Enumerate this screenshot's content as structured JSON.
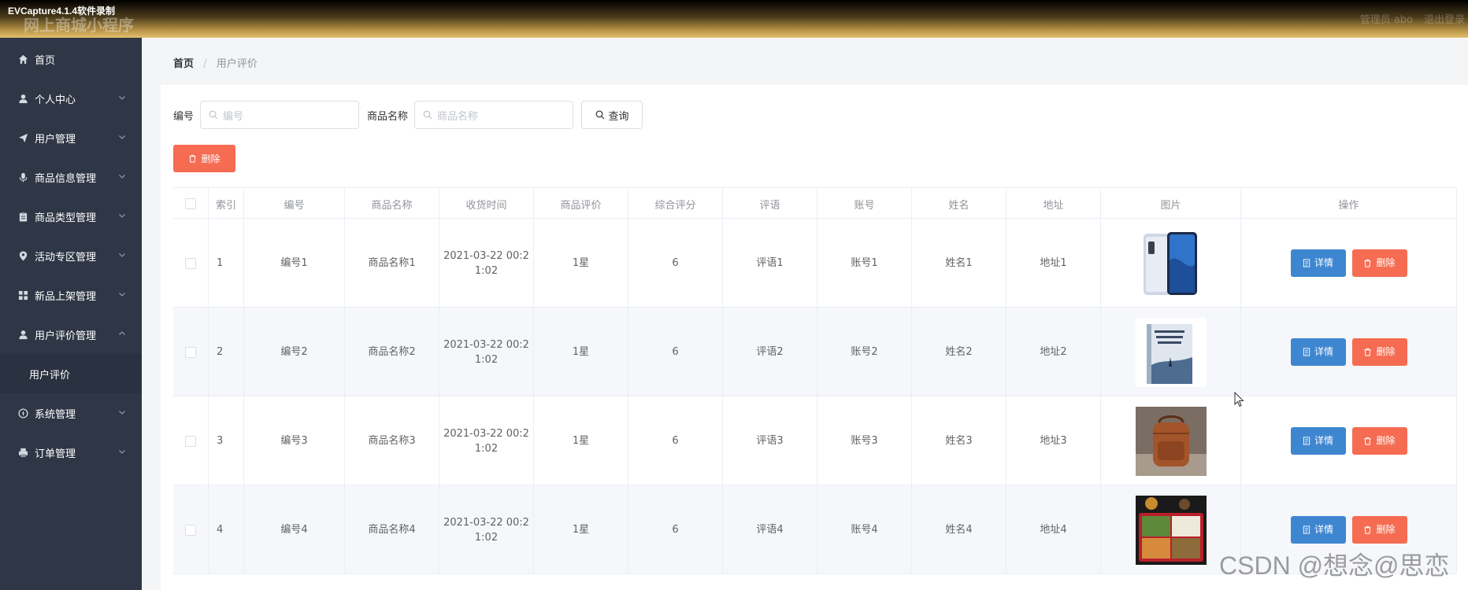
{
  "recorder": {
    "label": "EVCapture4.1.4软件录制"
  },
  "header": {
    "brand": "网上商城小程序",
    "user": "管理员 abo",
    "logout": "退出登录"
  },
  "sidebar": {
    "items": [
      {
        "label": "首页",
        "icon": "home-icon"
      },
      {
        "label": "个人中心",
        "icon": "user-icon"
      },
      {
        "label": "用户管理",
        "icon": "send-icon"
      },
      {
        "label": "商品信息管理",
        "icon": "mic-icon"
      },
      {
        "label": "商品类型管理",
        "icon": "clipboard-icon"
      },
      {
        "label": "活动专区管理",
        "icon": "location-icon"
      },
      {
        "label": "新品上架管理",
        "icon": "grid-icon"
      },
      {
        "label": "用户评价管理",
        "icon": "user-icon"
      },
      {
        "label": "系统管理",
        "icon": "settings-icon"
      },
      {
        "label": "订单管理",
        "icon": "printer-icon"
      }
    ],
    "sub_item": "用户评价"
  },
  "breadcrumb": {
    "home": "首页",
    "sep": "/",
    "current": "用户评价"
  },
  "search": {
    "field1_label": "编号",
    "field1_placeholder": "编号",
    "field2_label": "商品名称",
    "field2_placeholder": "商品名称",
    "query_label": "查询"
  },
  "toolbar": {
    "delete_label": "删除"
  },
  "table": {
    "columns": [
      "索引",
      "编号",
      "商品名称",
      "收货时间",
      "商品评价",
      "综合评分",
      "评语",
      "账号",
      "姓名",
      "地址",
      "图片",
      "操作"
    ],
    "rows": [
      {
        "index": "1",
        "code": "编号1",
        "name": "商品名称1",
        "time": "2021-03-22 00:2\n1:02",
        "rating": "1星",
        "score": "6",
        "comment": "评语1",
        "account": "账号1",
        "person": "姓名1",
        "address": "地址1",
        "image": "phone-image"
      },
      {
        "index": "2",
        "code": "编号2",
        "name": "商品名称2",
        "time": "2021-03-22 00:2\n1:02",
        "rating": "1星",
        "score": "6",
        "comment": "评语2",
        "account": "账号2",
        "person": "姓名2",
        "address": "地址2",
        "image": "book-image"
      },
      {
        "index": "3",
        "code": "编号3",
        "name": "商品名称3",
        "time": "2021-03-22 00:2\n1:02",
        "rating": "1星",
        "score": "6",
        "comment": "评语3",
        "account": "账号3",
        "person": "姓名3",
        "address": "地址3",
        "image": "bag-image"
      },
      {
        "index": "4",
        "code": "编号4",
        "name": "商品名称4",
        "time": "2021-03-22 00:2\n1:02",
        "rating": "1星",
        "score": "6",
        "comment": "评语4",
        "account": "账号4",
        "person": "姓名4",
        "address": "地址4",
        "image": "food-image"
      }
    ],
    "detail_label": "详情",
    "delete_label": "删除"
  },
  "colors": {
    "sidebar": "#2f3746",
    "primary": "#3f86d0",
    "danger": "#f56c52"
  },
  "watermark": "CSDN @想念@思恋"
}
